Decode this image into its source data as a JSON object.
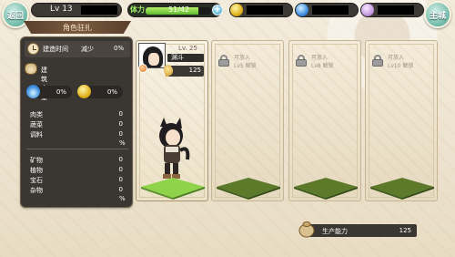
{
  "top_bar": {
    "back_label": "返回",
    "level": "Lv 13",
    "stamina_label": "体力",
    "stamina_value": "51/42",
    "stamina_fraction": 0.8,
    "main_label": "主城",
    "colors": {
      "stamina": "#5fb92f",
      "button": "#6fb9a7"
    }
  },
  "ribbon_title": "角色驻扎",
  "left_panel": {
    "build_time_label": "建造时间",
    "reduce_label": "减少",
    "reduce_value": "0%",
    "output_label": "建筑产量",
    "bonus_left": "0%",
    "bonus_right": "0%",
    "group1": [
      {
        "name": "肉类",
        "value": "0"
      },
      {
        "name": "蔬菜",
        "value": "0"
      },
      {
        "name": "调料",
        "value": "0"
      }
    ],
    "group1_unit": "%",
    "group2": [
      {
        "name": "矿物",
        "value": "0"
      },
      {
        "name": "植物",
        "value": "0"
      },
      {
        "name": "宝石",
        "value": "0"
      },
      {
        "name": "杂物",
        "value": "0"
      }
    ],
    "group2_unit": "%"
  },
  "character_card": {
    "level": "Lv. 25",
    "name": "渊斗",
    "power": "125"
  },
  "locked_slots": [
    {
      "title": "可放入",
      "requirement": "Lv5 解锁"
    },
    {
      "title": "可放入",
      "requirement": "Lv8 解锁"
    },
    {
      "title": "可放入",
      "requirement": "Lv10 解锁"
    }
  ],
  "production": {
    "label": "生产能力",
    "value": "125"
  }
}
